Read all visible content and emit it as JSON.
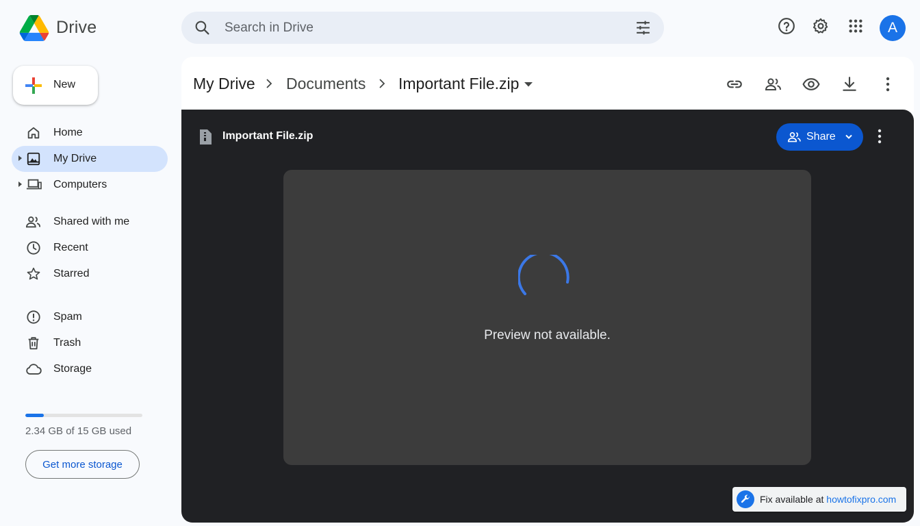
{
  "app": {
    "brand": "Drive"
  },
  "search": {
    "placeholder": "Search in Drive"
  },
  "user": {
    "avatar_letter": "A"
  },
  "sidebar": {
    "new_label": "New",
    "items": [
      {
        "label": "Home",
        "icon": "home-icon"
      },
      {
        "label": "My Drive",
        "icon": "my-drive-icon",
        "active": true
      },
      {
        "label": "Computers",
        "icon": "computers-icon"
      },
      {
        "label": "Shared with me",
        "icon": "shared-icon"
      },
      {
        "label": "Recent",
        "icon": "recent-icon"
      },
      {
        "label": "Starred",
        "icon": "star-icon"
      },
      {
        "label": "Spam",
        "icon": "spam-icon"
      },
      {
        "label": "Trash",
        "icon": "trash-icon"
      },
      {
        "label": "Storage",
        "icon": "cloud-icon"
      }
    ],
    "storage": {
      "used_fraction": 0.156,
      "text": "2.34 GB of 15 GB used",
      "button": "Get more storage"
    }
  },
  "breadcrumb": [
    "My Drive",
    "Documents",
    "Important File.zip"
  ],
  "preview": {
    "file_name": "Important File.zip",
    "share_label": "Share",
    "message": "Preview not available."
  },
  "fix_badge": {
    "prefix": "Fix available at ",
    "link": "howtofixpro.com"
  },
  "colors": {
    "accent": "#1a73e8",
    "share": "#0b57d0",
    "active_nav": "#d3e3fd",
    "dark_bg": "#202124",
    "stage_bg": "#3c3c3c"
  }
}
